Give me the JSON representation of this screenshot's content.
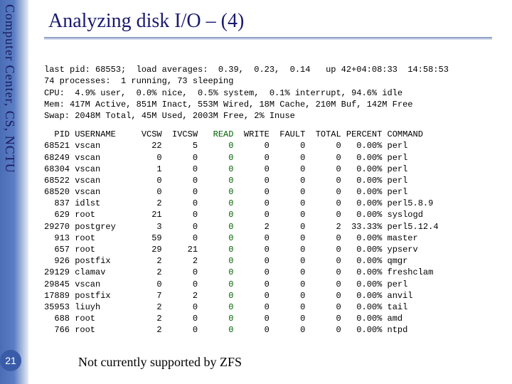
{
  "sidebar": {
    "org_text": "Computer Center, CS, NCTU",
    "page_number": "21"
  },
  "title": "Analyzing disk I/O – (4)",
  "footnote": "Not currently supported by ZFS",
  "terminal_header": {
    "line1": "last pid: 68553;  load averages:  0.39,  0.23,  0.14   up 42+04:08:33  14:58:53",
    "line2": "74 processes:  1 running, 73 sleeping",
    "line3": "CPU:  4.9% user,  0.0% nice,  0.5% system,  0.1% interrupt, 94.6% idle",
    "line4": "Mem: 417M Active, 851M Inact, 553M Wired, 18M Cache, 210M Buf, 142M Free",
    "line5": "Swap: 2048M Total, 45M Used, 2003M Free, 2% Inuse"
  },
  "columns": [
    "PID",
    "USERNAME",
    "VCSW",
    "IVCSW",
    "READ",
    "WRITE",
    "FAULT",
    "TOTAL",
    "PERCENT",
    "COMMAND"
  ],
  "rows": [
    {
      "pid": "68521",
      "user": "vscan",
      "vcsw": "22",
      "ivcsw": "5",
      "read": "0",
      "write": "0",
      "fault": "0",
      "total": "0",
      "percent": "0.00%",
      "cmd": "perl"
    },
    {
      "pid": "68249",
      "user": "vscan",
      "vcsw": "0",
      "ivcsw": "0",
      "read": "0",
      "write": "0",
      "fault": "0",
      "total": "0",
      "percent": "0.00%",
      "cmd": "perl"
    },
    {
      "pid": "68304",
      "user": "vscan",
      "vcsw": "1",
      "ivcsw": "0",
      "read": "0",
      "write": "0",
      "fault": "0",
      "total": "0",
      "percent": "0.00%",
      "cmd": "perl"
    },
    {
      "pid": "68522",
      "user": "vscan",
      "vcsw": "0",
      "ivcsw": "0",
      "read": "0",
      "write": "0",
      "fault": "0",
      "total": "0",
      "percent": "0.00%",
      "cmd": "perl"
    },
    {
      "pid": "68520",
      "user": "vscan",
      "vcsw": "0",
      "ivcsw": "0",
      "read": "0",
      "write": "0",
      "fault": "0",
      "total": "0",
      "percent": "0.00%",
      "cmd": "perl"
    },
    {
      "pid": "837",
      "user": "idlst",
      "vcsw": "2",
      "ivcsw": "0",
      "read": "0",
      "write": "0",
      "fault": "0",
      "total": "0",
      "percent": "0.00%",
      "cmd": "perl5.8.9"
    },
    {
      "pid": "629",
      "user": "root",
      "vcsw": "21",
      "ivcsw": "0",
      "read": "0",
      "write": "0",
      "fault": "0",
      "total": "0",
      "percent": "0.00%",
      "cmd": "syslogd"
    },
    {
      "pid": "29270",
      "user": "postgrey",
      "vcsw": "3",
      "ivcsw": "0",
      "read": "0",
      "write": "2",
      "fault": "0",
      "total": "2",
      "percent": "33.33%",
      "cmd": "perl5.12.4"
    },
    {
      "pid": "913",
      "user": "root",
      "vcsw": "59",
      "ivcsw": "0",
      "read": "0",
      "write": "0",
      "fault": "0",
      "total": "0",
      "percent": "0.00%",
      "cmd": "master"
    },
    {
      "pid": "657",
      "user": "root",
      "vcsw": "29",
      "ivcsw": "21",
      "read": "0",
      "write": "0",
      "fault": "0",
      "total": "0",
      "percent": "0.00%",
      "cmd": "ypserv"
    },
    {
      "pid": "926",
      "user": "postfix",
      "vcsw": "2",
      "ivcsw": "2",
      "read": "0",
      "write": "0",
      "fault": "0",
      "total": "0",
      "percent": "0.00%",
      "cmd": "qmgr"
    },
    {
      "pid": "29129",
      "user": "clamav",
      "vcsw": "2",
      "ivcsw": "0",
      "read": "0",
      "write": "0",
      "fault": "0",
      "total": "0",
      "percent": "0.00%",
      "cmd": "freshclam"
    },
    {
      "pid": "29845",
      "user": "vscan",
      "vcsw": "0",
      "ivcsw": "0",
      "read": "0",
      "write": "0",
      "fault": "0",
      "total": "0",
      "percent": "0.00%",
      "cmd": "perl"
    },
    {
      "pid": "17889",
      "user": "postfix",
      "vcsw": "7",
      "ivcsw": "2",
      "read": "0",
      "write": "0",
      "fault": "0",
      "total": "0",
      "percent": "0.00%",
      "cmd": "anvil"
    },
    {
      "pid": "35953",
      "user": "liuyh",
      "vcsw": "2",
      "ivcsw": "0",
      "read": "0",
      "write": "0",
      "fault": "0",
      "total": "0",
      "percent": "0.00%",
      "cmd": "tail"
    },
    {
      "pid": "688",
      "user": "root",
      "vcsw": "2",
      "ivcsw": "0",
      "read": "0",
      "write": "0",
      "fault": "0",
      "total": "0",
      "percent": "0.00%",
      "cmd": "amd"
    },
    {
      "pid": "766",
      "user": "root",
      "vcsw": "2",
      "ivcsw": "0",
      "read": "0",
      "write": "0",
      "fault": "0",
      "total": "0",
      "percent": "0.00%",
      "cmd": "ntpd"
    }
  ]
}
